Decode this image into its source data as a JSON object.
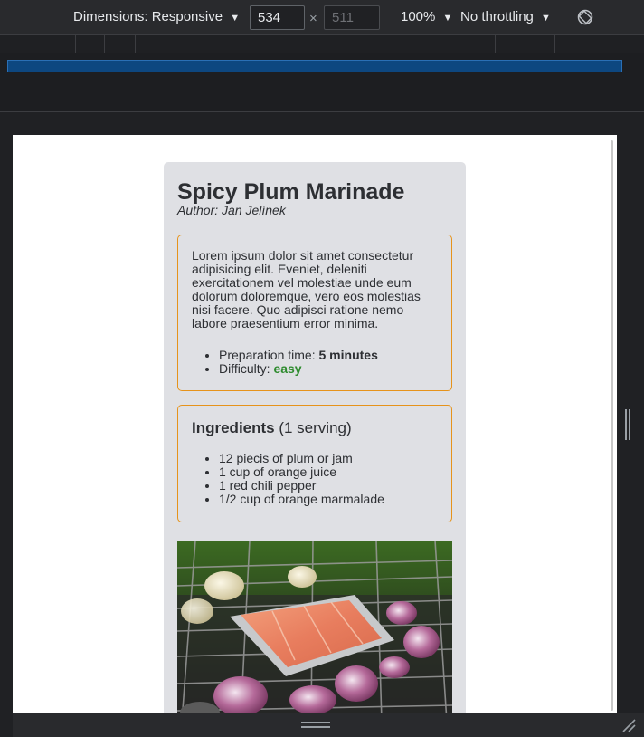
{
  "devtools": {
    "dimensions_label": "Dimensions: Responsive",
    "width_value": "534",
    "height_placeholder": "511",
    "times": "×",
    "zoom": "100%",
    "throttling": "No throttling",
    "caret": "▼",
    "icons": {
      "rotate": "rotate-icon",
      "resize": "resize-grip-icon"
    }
  },
  "recipe": {
    "title": "Spicy Plum Marinade",
    "author": "Author: Jan Jelínek",
    "description": "Lorem ipsum dolor sit amet consectetur adipisicing elit. Eveniet, deleniti exercitationem vel molestiae unde eum dolorum doloremque, vero eos molestias nisi facere. Quo adipisci ratione nemo labore praesentium error minima.",
    "prep_label": "Preparation time: ",
    "prep_value": "5 minutes",
    "difficulty_label": "Difficulty: ",
    "difficulty_value": "easy",
    "ingredients_heading": "Ingredients",
    "servings": " (1 serving)",
    "ingredients": [
      "12 piecis of plum or jam",
      "1 cup of orange juice",
      "1 red chili pepper",
      "1/2 cup of orange marmalade"
    ]
  },
  "colors": {
    "card_bg": "#dfe0e4",
    "box_border": "#e6931b",
    "easy": "#2e8b2e",
    "devtools_bg": "#292a2d",
    "breakpoint_bar": "#0d4780"
  }
}
